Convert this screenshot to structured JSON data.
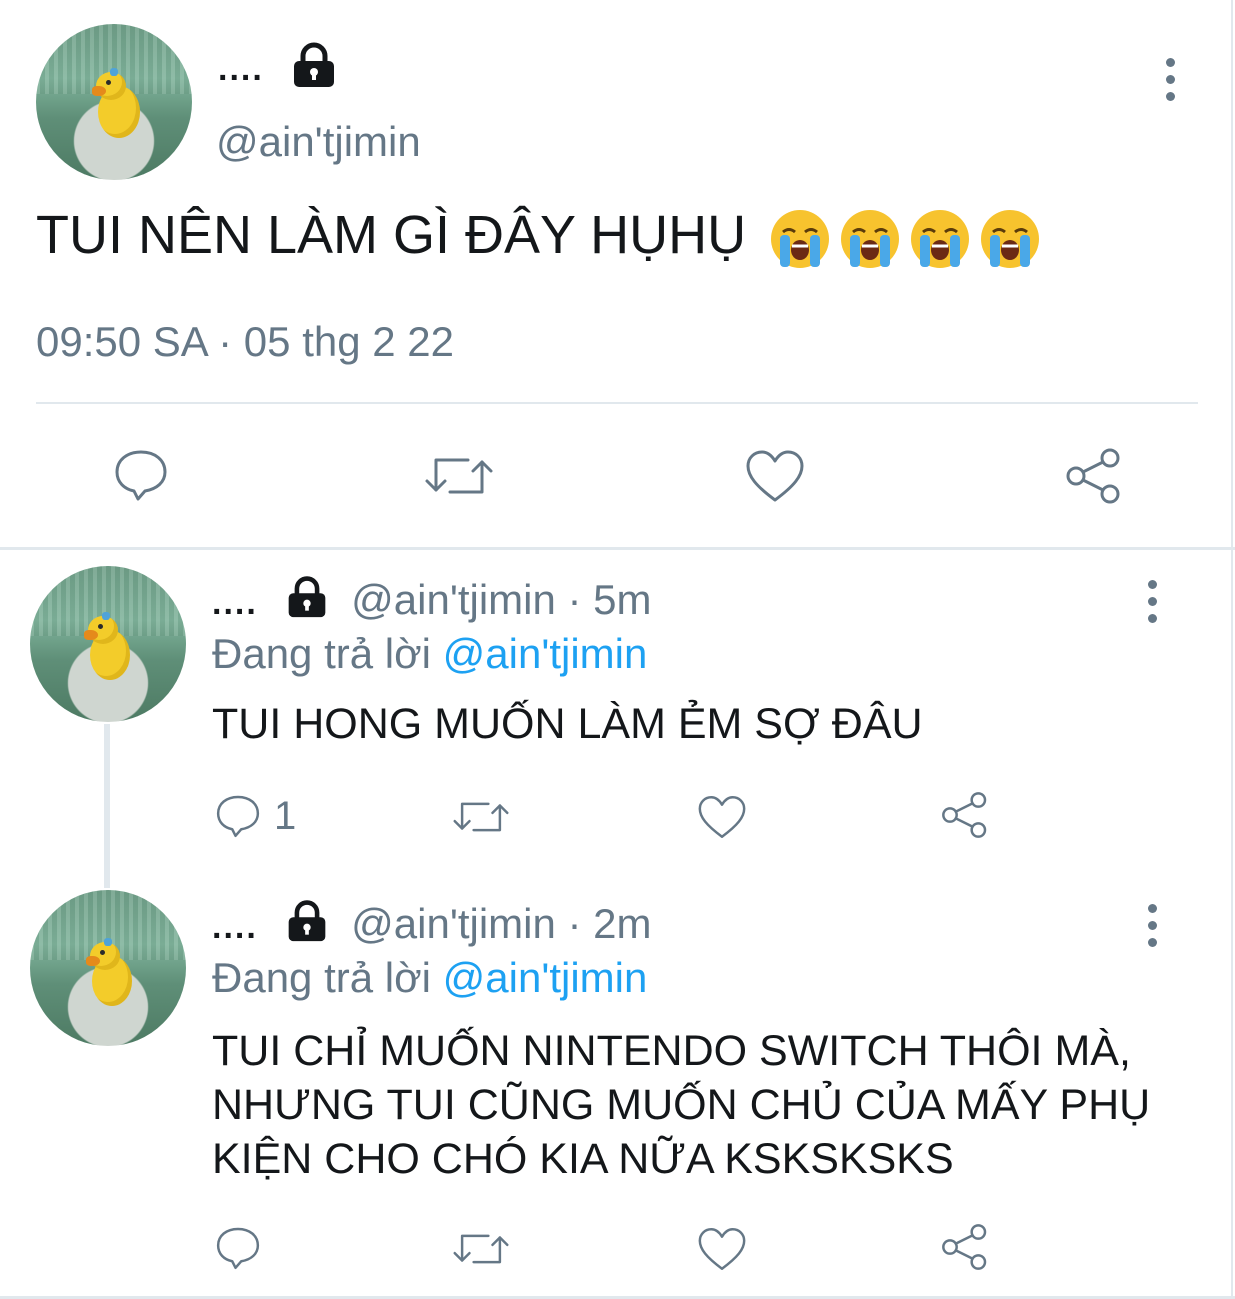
{
  "main_tweet": {
    "display_name": "....",
    "handle": "@ain'tjimin",
    "text": "TUI NÊN LÀM GÌ ĐÂY HỤHỤ",
    "emojis": [
      "loudly-crying-face",
      "loudly-crying-face",
      "loudly-crying-face",
      "loudly-crying-face"
    ],
    "timestamp": "09:50 SA · 05 thg 2 22",
    "actions": [
      "reply-icon",
      "retweet-icon",
      "like-icon",
      "share-icon"
    ]
  },
  "replies": [
    {
      "display_name": "....",
      "handle": "@ain'tjimin",
      "time": "· 5m",
      "replying_prefix": "Đang trả lời",
      "replying_to": "@ain'tjimin",
      "text_lines": [
        "TUI HONG MUỐN LÀM ẺM SỢ ĐÂU"
      ],
      "reply_count": "1"
    },
    {
      "display_name": "....",
      "handle": "@ain'tjimin",
      "time": "· 2m",
      "replying_prefix": "Đang trả lời",
      "replying_to": "@ain'tjimin",
      "text_lines": [
        "TUI CHỈ MUỐN NINTENDO SWITCH THÔI MÀ,",
        "NHƯNG TUI CŨNG MUỐN CHỦ CỦA MẤY PHỤ",
        "KIỆN CHO CHÓ KIA NỮA KSKSKSKS"
      ],
      "reply_count": ""
    }
  ],
  "colors": {
    "text": "#14171a",
    "muted": "#657786",
    "link": "#1da1f2",
    "divider": "#e1e8ed"
  }
}
